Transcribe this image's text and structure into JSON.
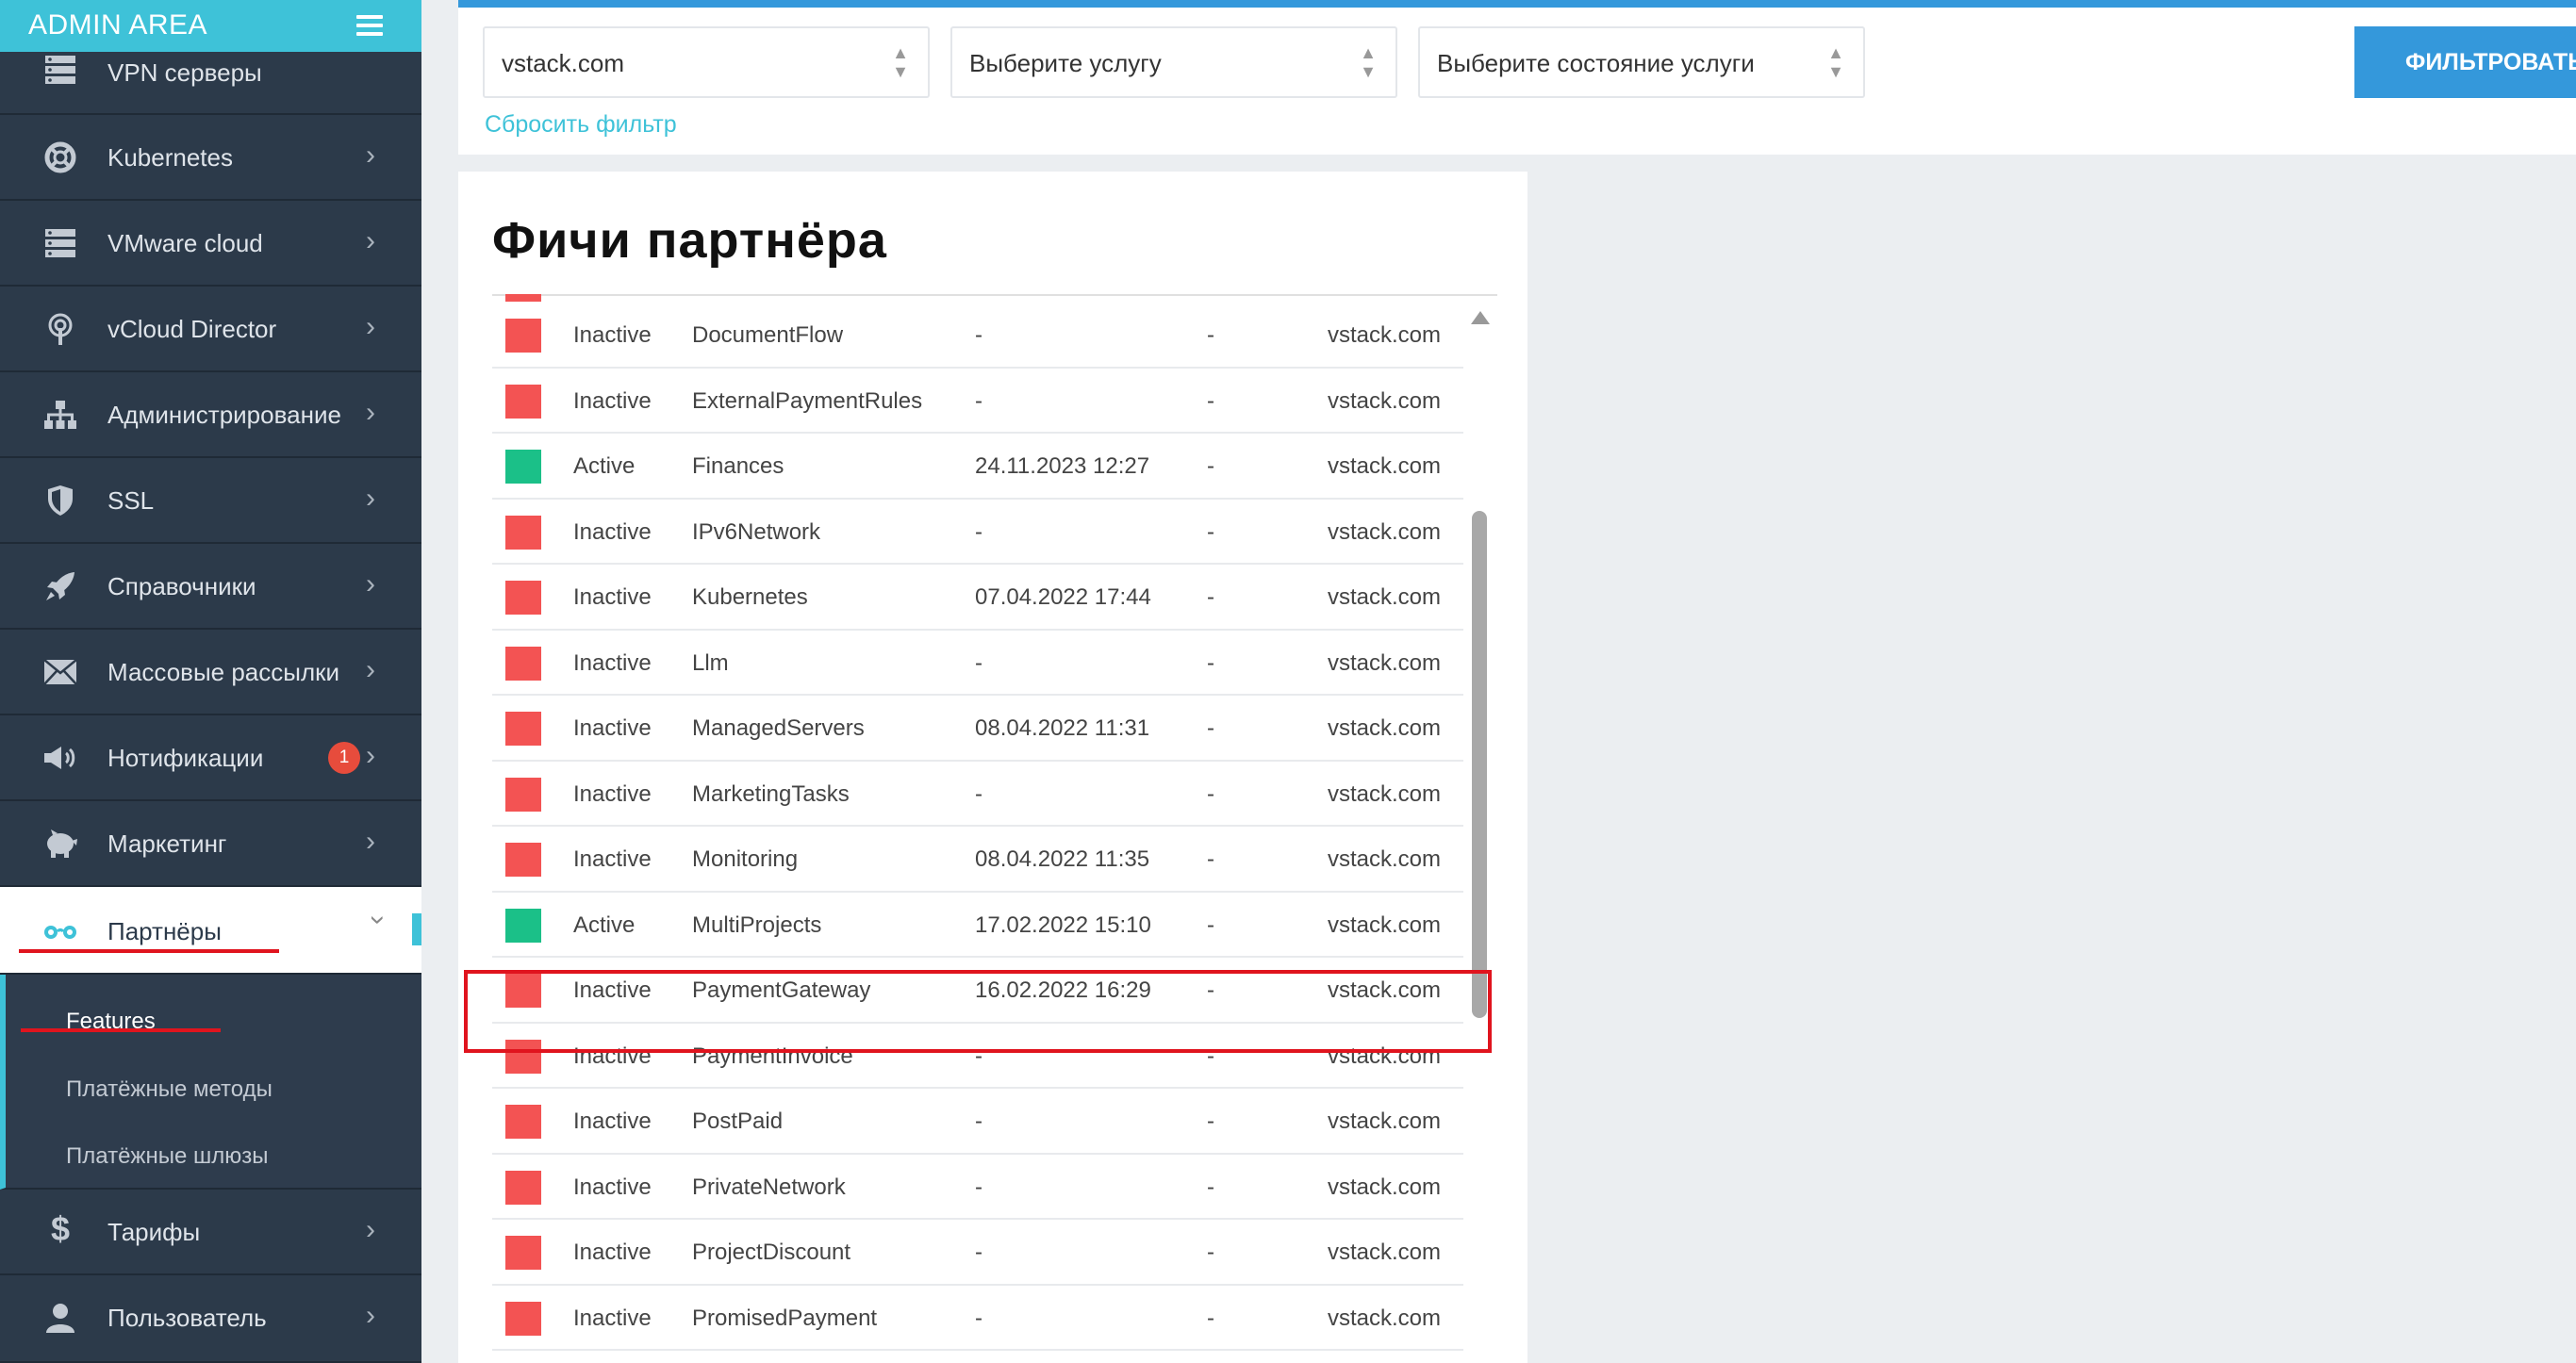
{
  "brand": {
    "title": "ADMIN AREA"
  },
  "sidebar": {
    "items": [
      {
        "label": "VPN серверы",
        "icon": "server-icon"
      },
      {
        "label": "Kubernetes",
        "icon": "lifebuoy-icon"
      },
      {
        "label": "VMware cloud",
        "icon": "server-icon"
      },
      {
        "label": "vCloud Director",
        "icon": "broadcast-icon"
      },
      {
        "label": "Администрирование",
        "icon": "sitemap-icon"
      },
      {
        "label": "SSL",
        "icon": "shield-icon"
      },
      {
        "label": "Справочники",
        "icon": "rocket-icon"
      },
      {
        "label": "Массовые рассылки",
        "icon": "envelope-icon"
      },
      {
        "label": "Нотификации",
        "icon": "megaphone-icon",
        "badge": "1"
      },
      {
        "label": "Маркетинг",
        "icon": "piggy-bank-icon"
      },
      {
        "label": "Партнёры",
        "icon": "glasses-icon"
      },
      {
        "label": "Тарифы",
        "icon": "dollar-icon"
      },
      {
        "label": "Пользователь",
        "icon": "user-icon"
      }
    ],
    "submenu": [
      {
        "label": "Features"
      },
      {
        "label": "Платёжные методы"
      },
      {
        "label": "Платёжные шлюзы"
      }
    ]
  },
  "filters": {
    "domain": "vstack.com",
    "service": "Выберите услугу",
    "state": "Выберите состояние услуги",
    "reset": "Сбросить фильтр",
    "submit": "ФИЛЬТРОВАТЬ"
  },
  "card": {
    "title": "Фичи партнёра"
  },
  "rows": [
    {
      "status": "Inactive",
      "name": "DocumentFlow",
      "date": "-",
      "extra": "-",
      "domain": "vstack.com"
    },
    {
      "status": "Inactive",
      "name": "ExternalPaymentRules",
      "date": "-",
      "extra": "-",
      "domain": "vstack.com"
    },
    {
      "status": "Active",
      "name": "Finances",
      "date": "24.11.2023 12:27",
      "extra": "-",
      "domain": "vstack.com"
    },
    {
      "status": "Inactive",
      "name": "IPv6Network",
      "date": "-",
      "extra": "-",
      "domain": "vstack.com"
    },
    {
      "status": "Inactive",
      "name": "Kubernetes",
      "date": "07.04.2022 17:44",
      "extra": "-",
      "domain": "vstack.com"
    },
    {
      "status": "Inactive",
      "name": "Llm",
      "date": "-",
      "extra": "-",
      "domain": "vstack.com"
    },
    {
      "status": "Inactive",
      "name": "ManagedServers",
      "date": "08.04.2022 11:31",
      "extra": "-",
      "domain": "vstack.com"
    },
    {
      "status": "Inactive",
      "name": "MarketingTasks",
      "date": "-",
      "extra": "-",
      "domain": "vstack.com"
    },
    {
      "status": "Inactive",
      "name": "Monitoring",
      "date": "08.04.2022 11:35",
      "extra": "-",
      "domain": "vstack.com"
    },
    {
      "status": "Active",
      "name": "MultiProjects",
      "date": "17.02.2022 15:10",
      "extra": "-",
      "domain": "vstack.com"
    },
    {
      "status": "Inactive",
      "name": "PaymentGateway",
      "date": "16.02.2022 16:29",
      "extra": "-",
      "domain": "vstack.com"
    },
    {
      "status": "Inactive",
      "name": "PaymentInvoice",
      "date": "-",
      "extra": "-",
      "domain": "vstack.com"
    },
    {
      "status": "Inactive",
      "name": "PostPaid",
      "date": "-",
      "extra": "-",
      "domain": "vstack.com"
    },
    {
      "status": "Inactive",
      "name": "PrivateNetwork",
      "date": "-",
      "extra": "-",
      "domain": "vstack.com"
    },
    {
      "status": "Inactive",
      "name": "ProjectDiscount",
      "date": "-",
      "extra": "-",
      "domain": "vstack.com"
    },
    {
      "status": "Inactive",
      "name": "PromisedPayment",
      "date": "-",
      "extra": "-",
      "domain": "vstack.com"
    }
  ],
  "colors": {
    "accent": "#3ec2d8",
    "button": "#3498db",
    "sidebar": "#2c3a4a",
    "active_status": "#1bc088",
    "inactive_status": "#f35353",
    "annotation": "#e0141e"
  }
}
